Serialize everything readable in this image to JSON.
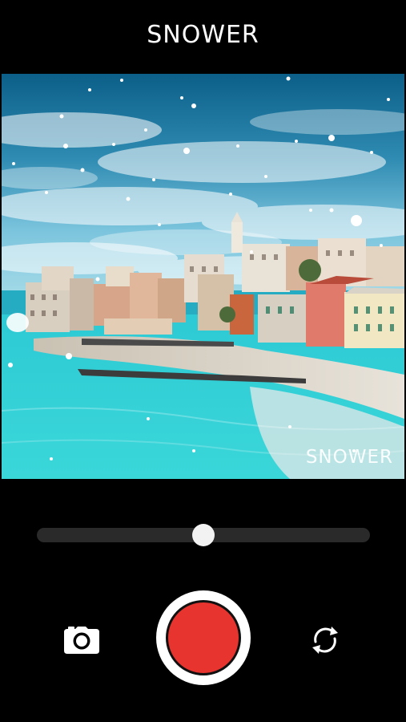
{
  "app": {
    "title": "SNOWER"
  },
  "preview": {
    "watermark": "SNOWER",
    "scene": "seaside-village-with-snowfall-filter"
  },
  "controls": {
    "slider_value": 0.5,
    "camera_icon": "camera-icon",
    "flip_icon": "switch-camera-icon",
    "record_color": "#e7342e"
  },
  "colors": {
    "background": "#000000",
    "accent": "#e7342e",
    "text": "#ffffff"
  }
}
